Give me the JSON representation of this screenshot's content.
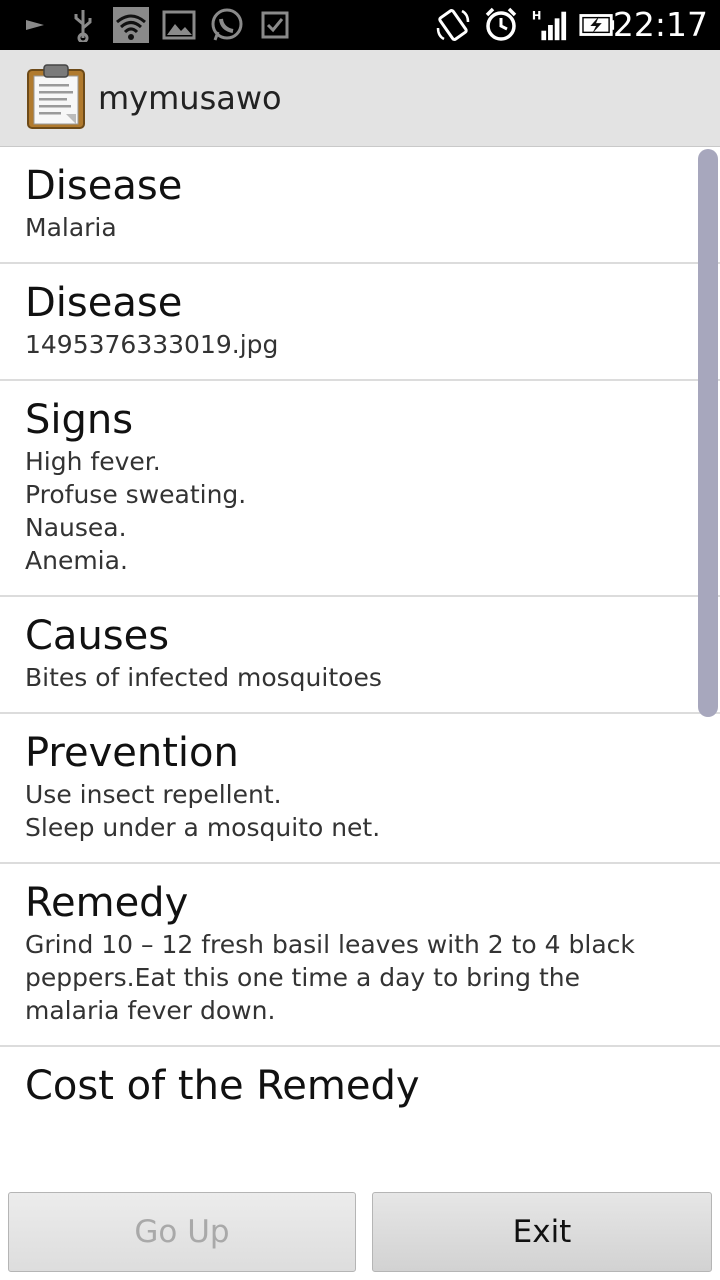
{
  "status_bar": {
    "time": "22:17",
    "icons": [
      "play-arrow-icon",
      "usb-icon",
      "wifi-icon",
      "image-icon",
      "whatsapp-icon",
      "checkbox-icon",
      "screen-rotate-icon",
      "alarm-icon",
      "signal-icon",
      "battery-charging-icon"
    ]
  },
  "action_bar": {
    "title": "mymusawo",
    "icon": "clipboard-icon"
  },
  "items": [
    {
      "title": "Disease",
      "body": "Malaria"
    },
    {
      "title": "Disease",
      "body": "1495376333019.jpg"
    },
    {
      "title": "Signs",
      "body": "High fever.\nProfuse sweating.\nNausea.\nAnemia."
    },
    {
      "title": "Causes",
      "body": "Bites of infected mosquitoes"
    },
    {
      "title": "Prevention",
      "body": "Use insect repellent.\nSleep under a mosquito net."
    },
    {
      "title": "Remedy",
      "body": "Grind 10 – 12 fresh basil leaves with 2 to 4 black peppers.Eat this one time a day to bring the malaria fever down."
    },
    {
      "title": "Cost of the Remedy",
      "body": ""
    }
  ],
  "buttons": {
    "go_up": "Go Up",
    "exit": "Exit"
  }
}
